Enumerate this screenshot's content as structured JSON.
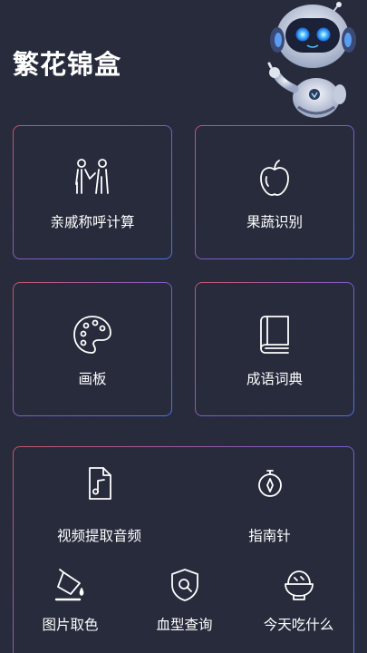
{
  "app": {
    "title": "繁花锦盒"
  },
  "cards": [
    {
      "label": "亲戚称呼计算",
      "icon": "people-icon"
    },
    {
      "label": "果蔬识别",
      "icon": "apple-icon"
    },
    {
      "label": "画板",
      "icon": "palette-icon"
    },
    {
      "label": "成语词典",
      "icon": "book-icon"
    }
  ],
  "tools": [
    {
      "label": "视频提取音频",
      "icon": "music-file-icon"
    },
    {
      "label": "指南针",
      "icon": "compass-icon"
    },
    {
      "label": "图片取色",
      "icon": "paint-bucket-icon"
    },
    {
      "label": "血型查询",
      "icon": "shield-search-icon"
    },
    {
      "label": "今天吃什么",
      "icon": "food-bowl-icon"
    }
  ],
  "colors": {
    "background": "#272b3c",
    "border_start": "#c4566c",
    "border_end": "#4e73e6",
    "mascot_eyes": "#4fc3ff"
  }
}
